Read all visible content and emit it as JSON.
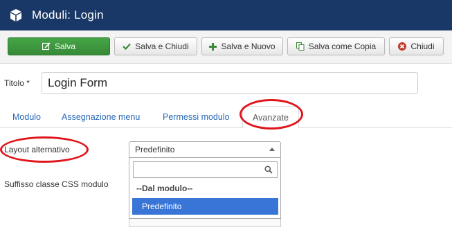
{
  "header": {
    "title": "Moduli: Login",
    "icon": "cube-icon"
  },
  "toolbar": {
    "save_label": "Salva",
    "save_close_label": "Salva e Chiudi",
    "save_new_label": "Salva e Nuovo",
    "save_copy_label": "Salva come Copia",
    "close_label": "Chiudi"
  },
  "form": {
    "title_label": "Titolo *",
    "title_value": "Login Form"
  },
  "tabs": [
    {
      "label": "Modulo"
    },
    {
      "label": "Assegnazione menu"
    },
    {
      "label": "Permessi modulo"
    },
    {
      "label": "Avanzate",
      "active": true
    }
  ],
  "advanced": {
    "layout_label": "Layout alternativo",
    "layout_selected": "Predefinito",
    "css_label": "Suffisso classe CSS modulo",
    "dropdown": {
      "search_value": "",
      "group_label": "--Dal modulo--",
      "options": [
        "Predefinito"
      ],
      "highlighted": "Predefinito"
    }
  },
  "colors": {
    "header_bg": "#1a3867",
    "save_green": "#46a546",
    "highlight_blue": "#3875d7",
    "annotation_red": "#e0151b",
    "tab_link": "#2a69b8"
  }
}
